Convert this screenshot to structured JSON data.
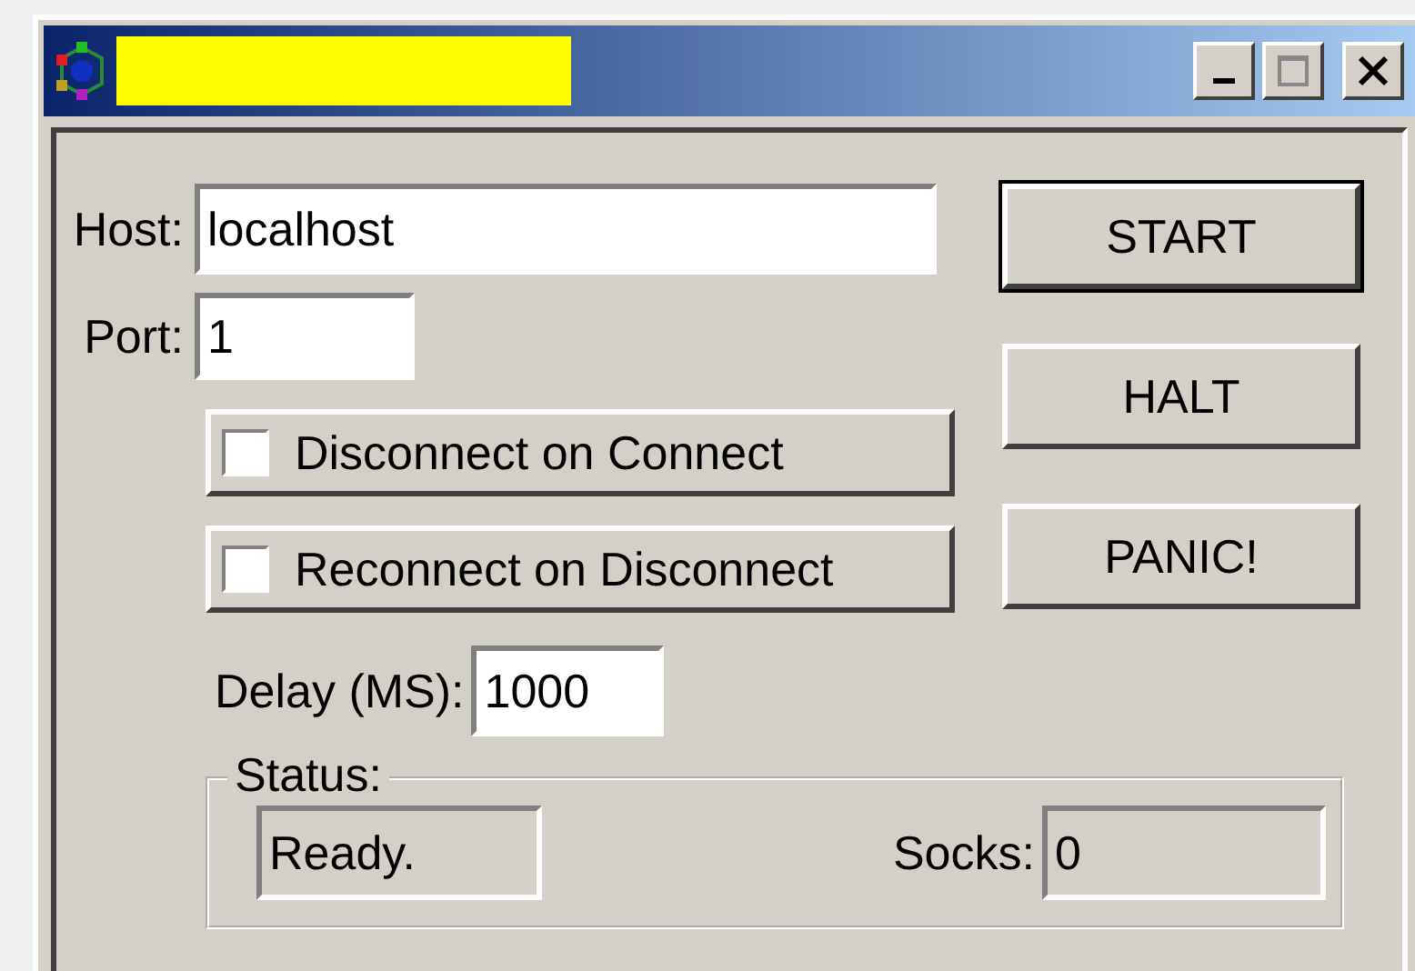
{
  "window": {
    "title_redacted": true
  },
  "host": {
    "label": "Host:",
    "value": "localhost"
  },
  "port": {
    "label": "Port:",
    "value": "1"
  },
  "options": [
    {
      "label": "Disconnect on Connect",
      "checked": false
    },
    {
      "label": "Reconnect on Disconnect",
      "checked": false
    }
  ],
  "delay": {
    "label": "Delay (MS):",
    "value": "1000"
  },
  "buttons": [
    {
      "label": "START",
      "default": true
    },
    {
      "label": "HALT",
      "default": false
    },
    {
      "label": "PANIC!",
      "default": false
    }
  ],
  "status": {
    "group_label": "Status:",
    "value": "Ready.",
    "socks_label": "Socks:",
    "socks_value": "0"
  }
}
